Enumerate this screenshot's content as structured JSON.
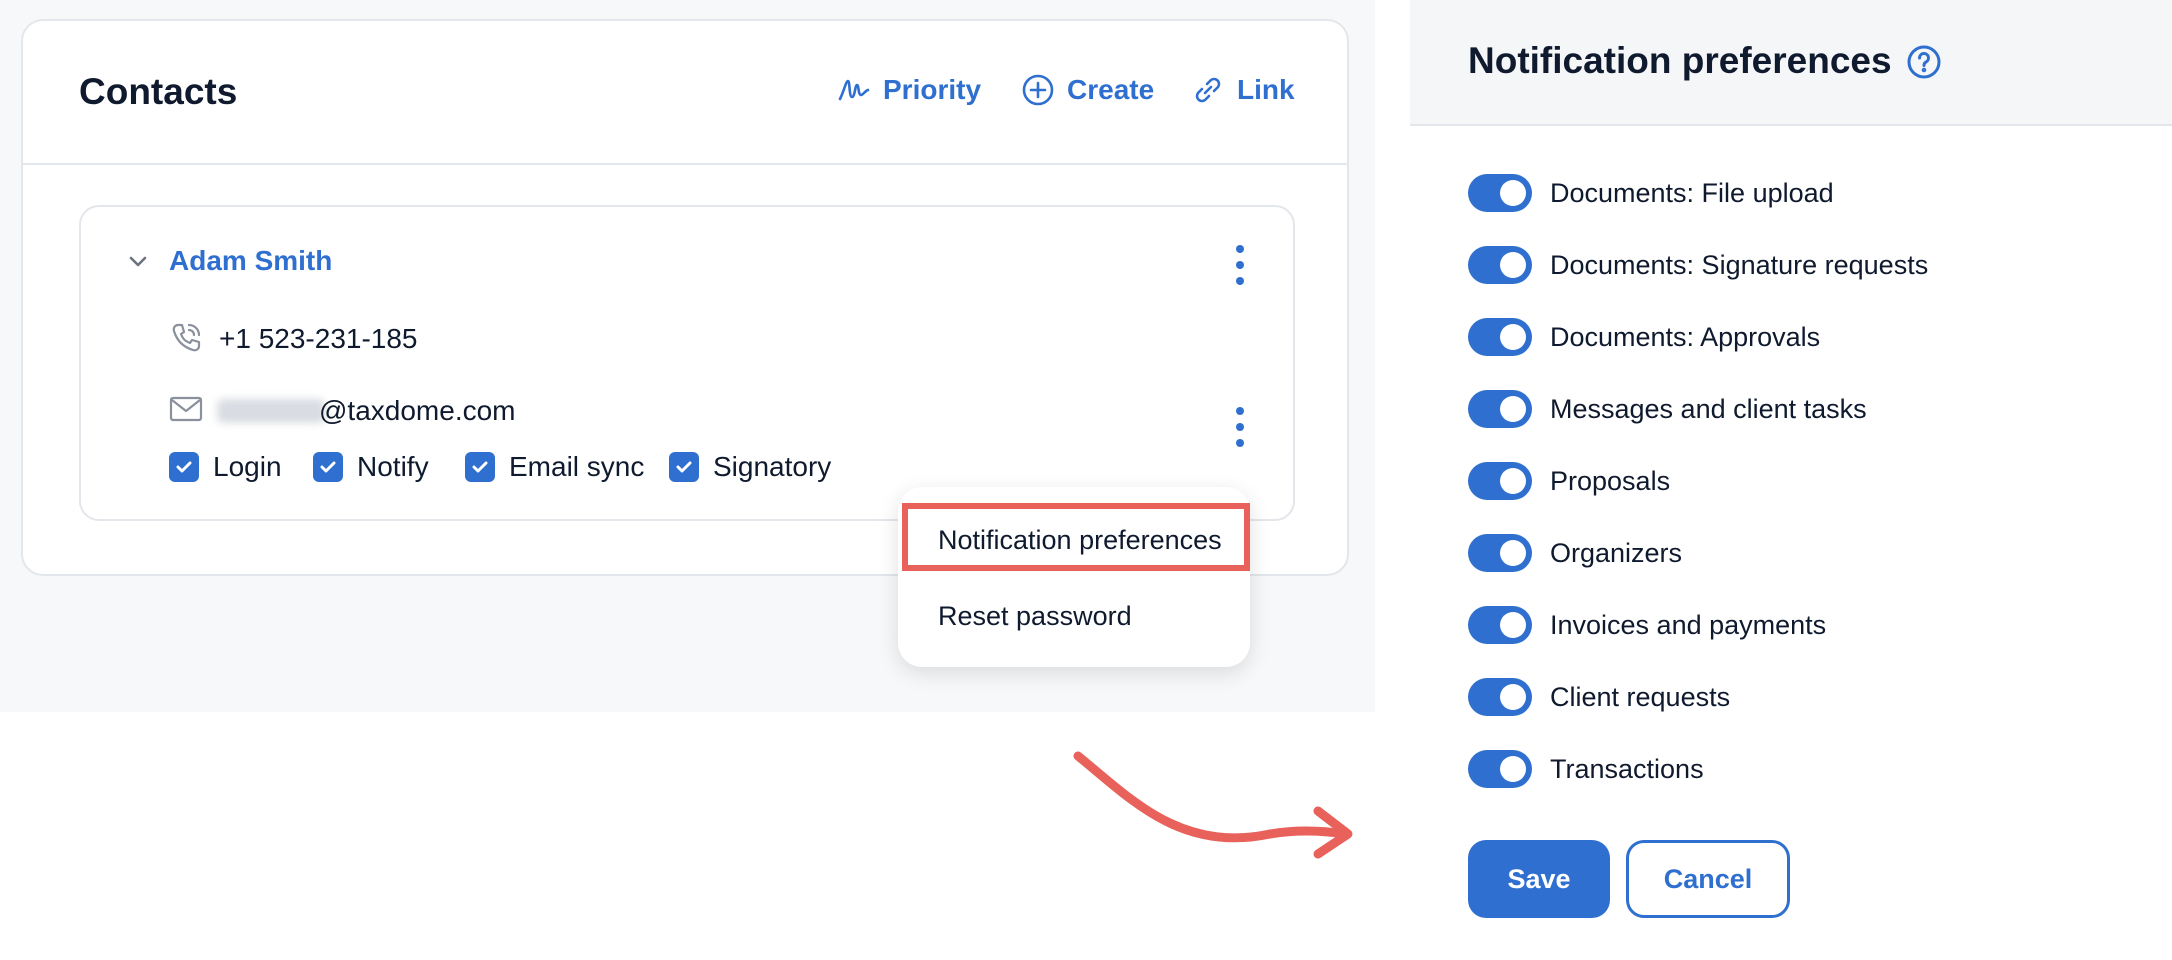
{
  "contacts": {
    "title": "Contacts",
    "actions": {
      "priority": "Priority",
      "create": "Create",
      "link": "Link"
    },
    "contact": {
      "name": "Adam Smith",
      "phone": "+1 523-231-185",
      "email_domain": "@taxdome.com",
      "checkboxes": {
        "login": "Login",
        "notify": "Notify",
        "email_sync": "Email sync",
        "signatory": "Signatory"
      }
    },
    "menu": {
      "notification_preferences": "Notification preferences",
      "reset_password": "Reset password"
    }
  },
  "panel": {
    "title": "Notification preferences",
    "preferences": [
      {
        "label": "Documents: File upload",
        "enabled": true
      },
      {
        "label": "Documents: Signature requests",
        "enabled": true
      },
      {
        "label": "Documents: Approvals",
        "enabled": true
      },
      {
        "label": "Messages and client tasks",
        "enabled": true
      },
      {
        "label": "Proposals",
        "enabled": true
      },
      {
        "label": "Organizers",
        "enabled": true
      },
      {
        "label": "Invoices and payments",
        "enabled": true
      },
      {
        "label": "Client requests",
        "enabled": true
      },
      {
        "label": "Transactions",
        "enabled": true
      }
    ],
    "save": "Save",
    "cancel": "Cancel"
  },
  "colors": {
    "accent": "#2f6fd0",
    "highlight": "#e8615a"
  },
  "icons": [
    "signature-icon",
    "plus-circle-icon",
    "link-icon",
    "chevron-down-icon",
    "kebab-icon",
    "phone-icon",
    "mail-icon",
    "check-icon",
    "help-icon",
    "arrow-icon"
  ]
}
